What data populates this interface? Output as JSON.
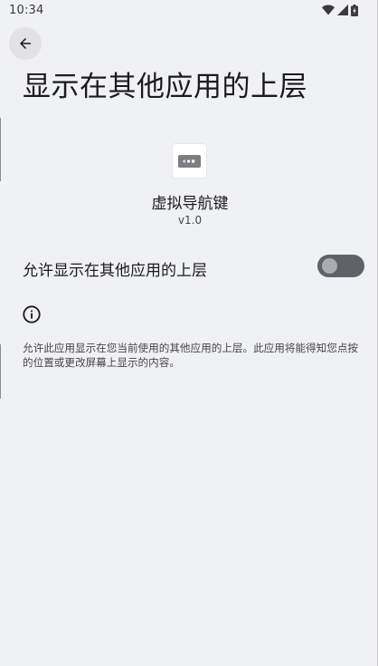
{
  "status_bar": {
    "time": "10:34",
    "icons": [
      "wifi-icon",
      "signal-icon",
      "battery-icon"
    ]
  },
  "header": {
    "back_icon": "arrow-back-icon",
    "title": "显示在其他应用的上层"
  },
  "app": {
    "icon": "keyboard-icon",
    "name": "虚拟导航键",
    "version": "v1.0"
  },
  "permission": {
    "label": "允许显示在其他应用的上层",
    "enabled": false
  },
  "info": {
    "icon": "info-icon",
    "text": "允许此应用显示在您当前使用的其他应用的上层。此应用将能得知您点按的位置或更改屏幕上显示的内容。"
  },
  "colors": {
    "background": "#f0f1f4",
    "toggle_track_off": "#5f6266",
    "toggle_thumb_off": "#a9acb0",
    "text_primary": "#1b1b1f",
    "text_secondary": "#46464a"
  }
}
